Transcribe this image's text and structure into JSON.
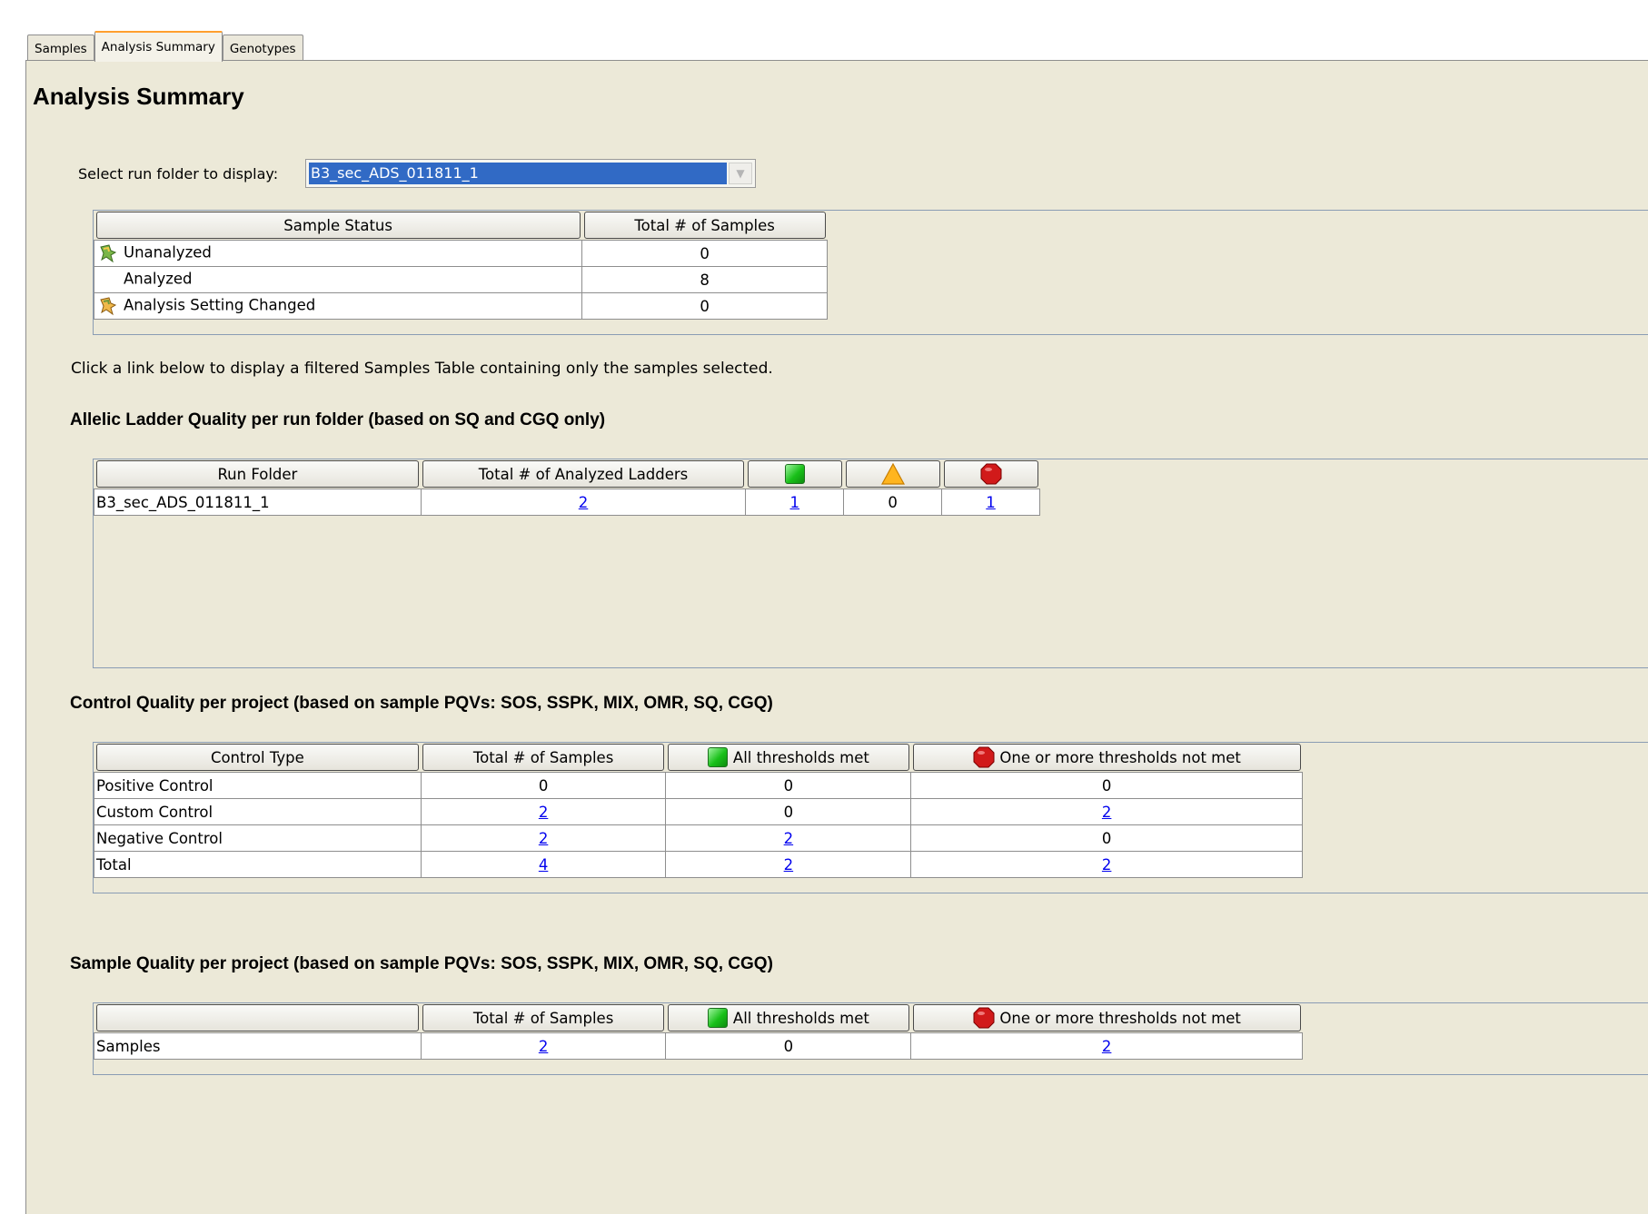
{
  "tabs": [
    {
      "label": "Samples",
      "active": false
    },
    {
      "label": "Analysis Summary",
      "active": true
    },
    {
      "label": "Genotypes",
      "active": false
    }
  ],
  "page_title": "Analysis Summary",
  "run_folder_select": {
    "label": "Select run folder to display:",
    "value": "B3_sec_ADS_011811_1"
  },
  "sample_status": {
    "headers": [
      "Sample Status",
      "Total # of Samples"
    ],
    "rows": [
      {
        "status": "Unanalyzed",
        "icon": "unanalyzed-icon",
        "total": "0"
      },
      {
        "status": "Analyzed",
        "icon": "",
        "total": "8"
      },
      {
        "status": "Analysis Setting Changed",
        "icon": "setting-changed-icon",
        "total": "0"
      }
    ]
  },
  "instruction_text": "Click a link below to display a filtered Samples Table containing only the samples selected.",
  "ladder_section": {
    "title": "Allelic Ladder Quality per run folder (based on SQ and CGQ only)",
    "headers": [
      "Run Folder",
      "Total # of Analyzed Ladders"
    ],
    "rows": [
      {
        "run_folder": "B3_sec_ADS_011811_1",
        "total": "2",
        "green": "1",
        "yellow": "0",
        "red": "1"
      }
    ]
  },
  "control_section": {
    "title": "Control Quality per project (based on sample PQVs: SOS, SSPK, MIX, OMR, SQ, CGQ)",
    "headers": [
      "Control Type",
      "Total # of Samples",
      "All thresholds met",
      "One or more thresholds not met"
    ],
    "rows": [
      {
        "type": "Positive Control",
        "total": "0",
        "met": "0",
        "not_met": "0"
      },
      {
        "type": "Custom Control",
        "total": "2",
        "met": "0",
        "not_met": "2"
      },
      {
        "type": "Negative Control",
        "total": "2",
        "met": "2",
        "not_met": "0"
      },
      {
        "type": "Total",
        "total": "4",
        "met": "2",
        "not_met": "2"
      }
    ]
  },
  "sample_section": {
    "title": "Sample Quality per project (based on sample PQVs: SOS, SSPK, MIX, OMR, SQ, CGQ)",
    "headers": [
      "",
      "Total # of Samples",
      "All thresholds met",
      "One or more thresholds not met"
    ],
    "rows": [
      {
        "type": "Samples",
        "total": "2",
        "met": "0",
        "not_met": "2"
      }
    ]
  },
  "colors": {
    "link": "#0000ee",
    "selection": "#316ac5",
    "panel": "#ece9d8",
    "active_tab_accent": "#ff9f2e"
  }
}
